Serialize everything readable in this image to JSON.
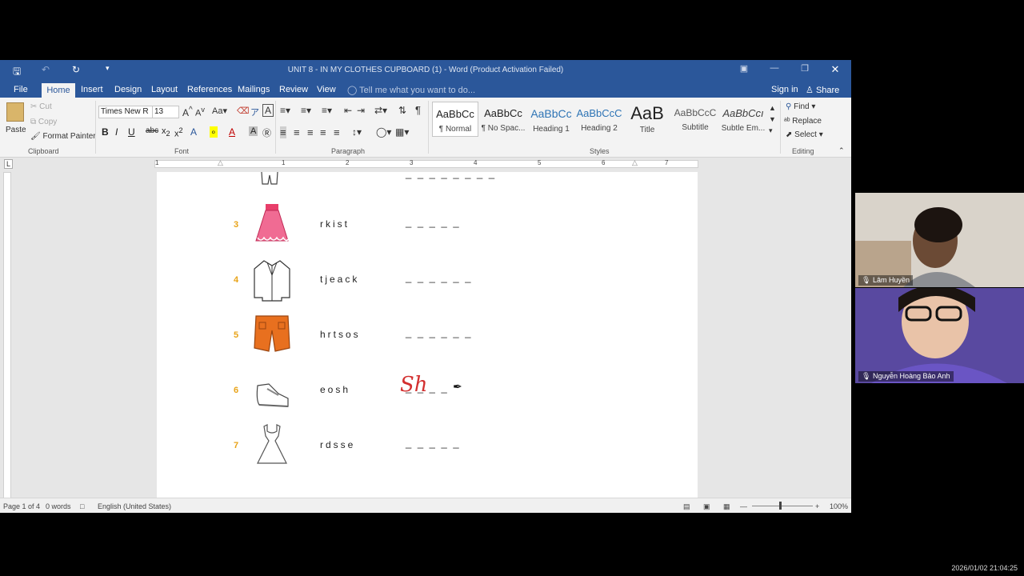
{
  "window": {
    "title": "UNIT 8 - IN MY CLOTHES CUPBOARD (1) - Word (Product Activation Failed)",
    "controls": [
      "ribbon-options-icon",
      "minimize-icon",
      "restore-icon",
      "close-icon"
    ]
  },
  "tabs": [
    "File",
    "Home",
    "Insert",
    "Design",
    "Layout",
    "References",
    "Mailings",
    "Review",
    "View"
  ],
  "tell_me": "Tell me what you want to do...",
  "sign_in": "Sign in",
  "share": "Share",
  "ribbon": {
    "clipboard": {
      "paste": "Paste",
      "cut": "Cut",
      "copy": "Copy",
      "format_painter": "Format Painter",
      "label": "Clipboard"
    },
    "font": {
      "name": "Times New R",
      "size": "13",
      "label": "Font"
    },
    "paragraph": {
      "label": "Paragraph"
    },
    "styles": {
      "label": "Styles",
      "items": [
        {
          "preview": "AaBbCc",
          "name": "¶ Normal"
        },
        {
          "preview": "AaBbCc",
          "name": "¶ No Spac..."
        },
        {
          "preview": "AaBbCc",
          "name": "Heading 1"
        },
        {
          "preview": "AaBbCcC",
          "name": "Heading 2"
        },
        {
          "preview": "AaB",
          "name": "Title"
        },
        {
          "preview": "AaBbCcC",
          "name": "Subtitle"
        },
        {
          "preview": "AaBbCcı",
          "name": "Subtle Em..."
        }
      ]
    },
    "editing": {
      "find": "Find",
      "replace": "Replace",
      "select": "Select",
      "label": "Editing"
    }
  },
  "ruler_numbers": [
    "1",
    "1",
    "2",
    "3",
    "4",
    "5",
    "6",
    "7"
  ],
  "exercise": [
    {
      "num": "3",
      "scrambled": "rkist",
      "blanks": "_ _ _ _ _",
      "icon": "skirt-icon"
    },
    {
      "num": "4",
      "scrambled": "tjeack",
      "blanks": "_ _ _ _ _ _",
      "icon": "jacket-icon"
    },
    {
      "num": "5",
      "scrambled": "hrtsos",
      "blanks": "_ _ _ _ _ _",
      "icon": "shorts-icon"
    },
    {
      "num": "6",
      "scrambled": "eosh",
      "blanks": "_ _ _ _",
      "icon": "shoe-icon",
      "handwritten": "Sh"
    },
    {
      "num": "7",
      "scrambled": "rdsse",
      "blanks": "_ _ _ _ _",
      "icon": "dress-icon"
    }
  ],
  "top_partial_blanks": "_ _ _ _ _ _ _ _",
  "status": {
    "page": "Page 1 of 4",
    "words": "0 words",
    "language": "English (United States)",
    "zoom": "100%"
  },
  "participants": [
    {
      "name": "Lâm Huyền"
    },
    {
      "name": "Nguyễn Hoàng Bảo Anh"
    }
  ],
  "timestamp": "2026/01/02 21:04:25"
}
